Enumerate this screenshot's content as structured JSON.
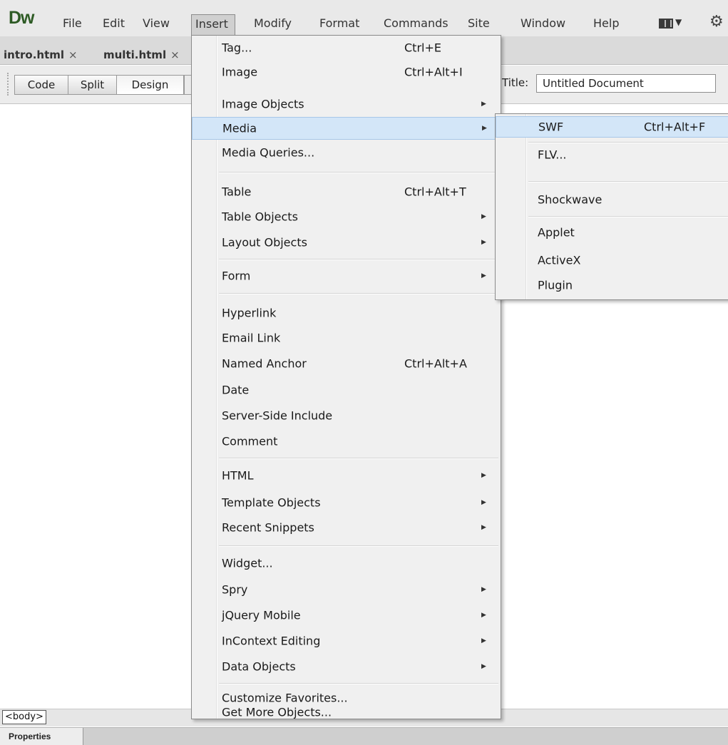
{
  "app": {
    "logo": "Dw"
  },
  "menubar": {
    "items": [
      "File",
      "Edit",
      "View",
      "Insert",
      "Modify",
      "Format",
      "Commands",
      "Site",
      "Window",
      "Help"
    ],
    "active": "Insert"
  },
  "tabs": [
    {
      "label": "intro.html",
      "close": "×"
    },
    {
      "label": "multi.html",
      "close": "×"
    }
  ],
  "toolbar": {
    "code": "Code",
    "split": "Split",
    "design": "Design",
    "title_label": "Title:",
    "title_value": "Untitled Document"
  },
  "insert_menu": {
    "items": [
      {
        "label": "Tag...",
        "shortcut": "Ctrl+E"
      },
      {
        "label": "Image",
        "shortcut": "Ctrl+Alt+I"
      },
      {
        "label": "Image Objects",
        "shortcut": ""
      },
      {
        "label": "Media",
        "shortcut": ""
      },
      {
        "label": "Media Queries...",
        "shortcut": ""
      },
      {
        "label": "Table",
        "shortcut": "Ctrl+Alt+T"
      },
      {
        "label": "Table Objects",
        "shortcut": ""
      },
      {
        "label": "Layout Objects",
        "shortcut": ""
      },
      {
        "label": "Form",
        "shortcut": ""
      },
      {
        "label": "Hyperlink",
        "shortcut": ""
      },
      {
        "label": "Email Link",
        "shortcut": ""
      },
      {
        "label": "Named Anchor",
        "shortcut": "Ctrl+Alt+A"
      },
      {
        "label": "Date",
        "shortcut": ""
      },
      {
        "label": "Server-Side Include",
        "shortcut": ""
      },
      {
        "label": "Comment",
        "shortcut": ""
      },
      {
        "label": "HTML",
        "shortcut": ""
      },
      {
        "label": "Template Objects",
        "shortcut": ""
      },
      {
        "label": "Recent Snippets",
        "shortcut": ""
      },
      {
        "label": "Widget...",
        "shortcut": ""
      },
      {
        "label": "Spry",
        "shortcut": ""
      },
      {
        "label": "jQuery Mobile",
        "shortcut": ""
      },
      {
        "label": "InContext Editing",
        "shortcut": ""
      },
      {
        "label": "Data Objects",
        "shortcut": ""
      },
      {
        "label": "Customize Favorites...",
        "shortcut": ""
      },
      {
        "label": "Get More Objects...",
        "shortcut": ""
      }
    ]
  },
  "media_submenu": {
    "items": [
      {
        "label": "SWF",
        "shortcut": "Ctrl+Alt+F"
      },
      {
        "label": "FLV...",
        "shortcut": ""
      },
      {
        "label": "Shockwave",
        "shortcut": ""
      },
      {
        "label": "Applet",
        "shortcut": ""
      },
      {
        "label": "ActiveX",
        "shortcut": ""
      },
      {
        "label": "Plugin",
        "shortcut": ""
      }
    ]
  },
  "status": {
    "tag": "<body>"
  },
  "panels": {
    "properties": "Properties"
  },
  "colors": {
    "logo": "#2e5b25",
    "menu_highlight": "#d3e6f8",
    "menu_highlight_border": "#a7c7e8",
    "menu_bg": "#f0f0f0"
  },
  "icons": [
    "workspace-layout-icon",
    "gear-icon",
    "submenu-arrow-icon",
    "close-icon"
  ]
}
